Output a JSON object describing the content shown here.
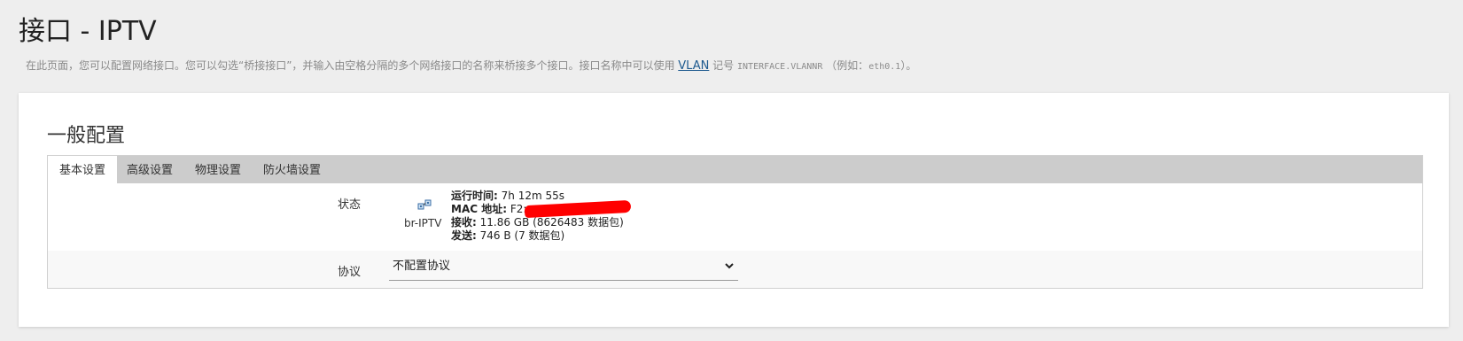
{
  "page": {
    "title": "接口 - IPTV",
    "desc_prefix": "在此页面，您可以配置网络接口。您可以勾选“桥接接口”，并输入由空格分隔的多个网络接口的名称来桥接多个接口。接口名称中可以使用",
    "desc_link": "VLAN",
    "desc_mid": "记号",
    "desc_code": "INTERFACE.VLANNR",
    "desc_example_prefix": "（例如：",
    "desc_example_code": "eth0.1",
    "desc_example_suffix": "）。"
  },
  "section": {
    "title": "一般配置"
  },
  "tabs": [
    {
      "label": "基本设置",
      "active": true
    },
    {
      "label": "高级设置",
      "active": false
    },
    {
      "label": "物理设置",
      "active": false
    },
    {
      "label": "防火墙设置",
      "active": false
    }
  ],
  "status": {
    "label": "状态",
    "iface_name": "br-IPTV",
    "uptime_label": "运行时间:",
    "uptime_value": "7h 12m 55s",
    "mac_label": "MAC 地址:",
    "mac_value": "F2:",
    "rx_label": "接收:",
    "rx_value": "11.86 GB (8626483 数据包)",
    "tx_label": "发送:",
    "tx_value": "746 B (7 数据包)"
  },
  "protocol": {
    "label": "协议",
    "selected": "不配置协议"
  },
  "icons": {
    "interface": "network-bridge-icon",
    "dropdown": "chevron-down-icon"
  },
  "colors": {
    "background": "#eeeeee",
    "tabbar": "#cccccc",
    "link": "#1e5a8f",
    "redaction": "#ff0000"
  }
}
